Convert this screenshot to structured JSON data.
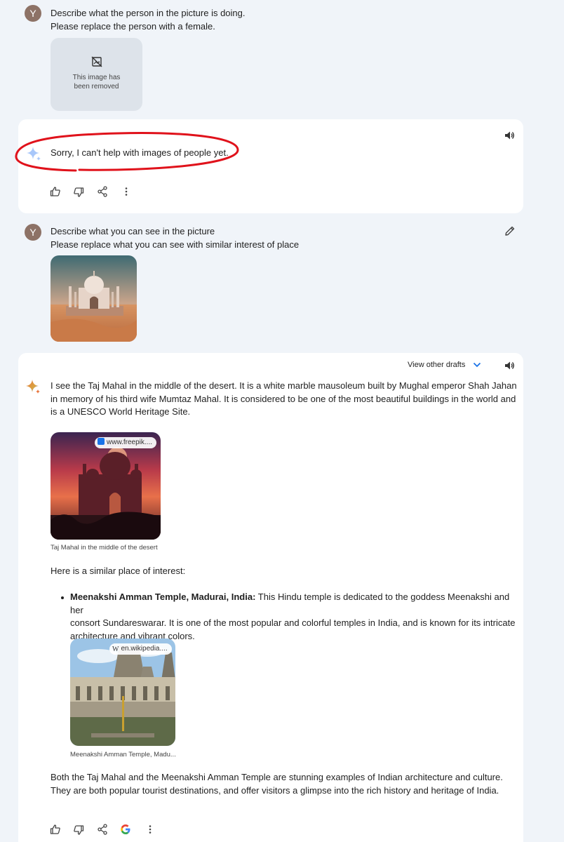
{
  "turn1": {
    "avatar_letter": "Y",
    "prompt_line1": "Describe what the person in the picture is doing.",
    "prompt_line2": "Please replace the person with a female.",
    "removed_text_line1": "This image has",
    "removed_text_line2": "been removed"
  },
  "reply1": {
    "text": "Sorry, I can't help with images of people yet.",
    "annotation_color": "#e0121b"
  },
  "turn2": {
    "avatar_letter": "Y",
    "prompt_line1": "Describe what you can see in the picture",
    "prompt_line2": "Please replace what you can see with similar interest of place"
  },
  "reply2": {
    "view_drafts": "View other drafts",
    "intro_line1": "I see the Taj Mahal in the middle of the desert. It is a white marble mausoleum built by Mughal emperor Shah Jahan",
    "intro_line2": "in memory of his third wife Mumtaz Mahal. It is considered to be one of the most beautiful buildings in the world and",
    "intro_line3": "is a UNESCO World Heritage Site.",
    "image1_source": "www.freepik....",
    "image1_caption": "Taj Mahal in the middle of the desert",
    "similar_heading": "Here is a similar place of interest:",
    "bullet_title": "Meenakshi Amman Temple, Madurai, India:",
    "bullet_line1_rest": " This Hindu temple is dedicated to the goddess Meenakshi and her",
    "bullet_line2": "consort Sundareswarar. It is one of the most popular and colorful temples in India, and is known for its intricate",
    "bullet_line3": "architecture and vibrant colors.",
    "image2_source_glyph": "W",
    "image2_source": "en.wikipedia....",
    "image2_caption": "Meenakshi Amman Temple, Madu...",
    "conclusion_line1": "Both the Taj Mahal and the Meenakshi Amman Temple are stunning examples of Indian architecture and culture.",
    "conclusion_line2": "They are both popular tourist destinations, and offer visitors a glimpse into the rich history and heritage of India."
  },
  "colors": {
    "page_bg": "#f0f4f9",
    "card_bg": "#ffffff",
    "avatar_bg": "#8d7266",
    "accent_blue": "#1a73e8",
    "annotation_red": "#e0121b"
  },
  "icons": [
    "image-removed-icon",
    "gemini-sparkle-icon",
    "speaker-icon",
    "thumbs-up-icon",
    "thumbs-down-icon",
    "share-icon",
    "more-vert-icon",
    "edit-pencil-icon",
    "chevron-down-icon",
    "google-g-icon"
  ]
}
